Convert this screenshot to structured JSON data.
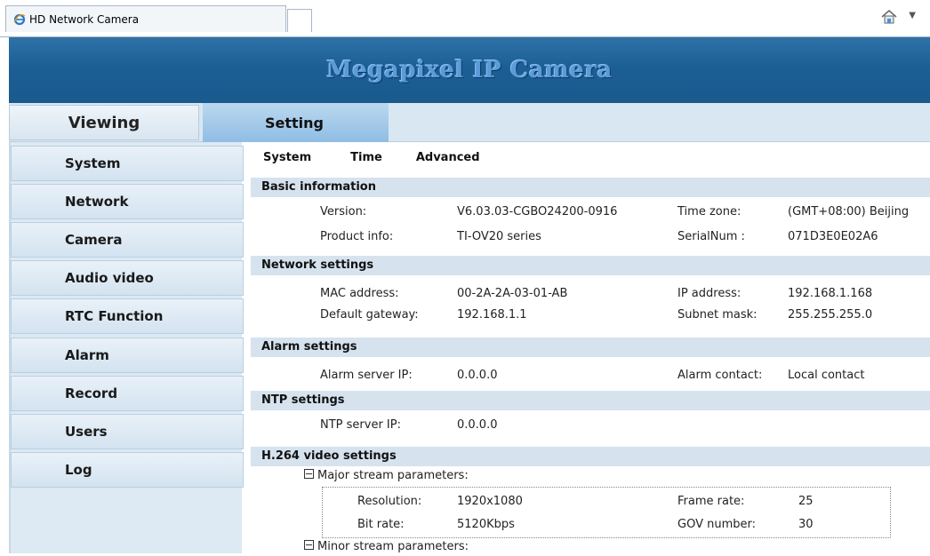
{
  "browser": {
    "tab_title": "HD Network Camera"
  },
  "banner": {
    "title": "Megapixel IP Camera"
  },
  "nav": {
    "viewing": "Viewing",
    "setting": "Setting"
  },
  "sidebar": {
    "items": [
      {
        "label": "System"
      },
      {
        "label": "Network"
      },
      {
        "label": "Camera"
      },
      {
        "label": "Audio video"
      },
      {
        "label": "RTC Function"
      },
      {
        "label": "Alarm"
      },
      {
        "label": "Record"
      },
      {
        "label": "Users"
      },
      {
        "label": "Log"
      }
    ]
  },
  "subtabs": [
    "System",
    "Time",
    "Advanced"
  ],
  "basic": {
    "heading": "Basic information",
    "version_label": "Version:",
    "version": "V6.03.03-CGBO24200-0916",
    "timezone_label": "Time zone:",
    "timezone": "(GMT+08:00) Beijing",
    "product_label": "Product info:",
    "product": "TI-OV20 series",
    "serial_label": "SerialNum :",
    "serial": "071D3E0E02A6"
  },
  "network": {
    "heading": "Network settings",
    "mac_label": "MAC address:",
    "mac": "00-2A-2A-03-01-AB",
    "ip_label": "IP address:",
    "ip": "192.168.1.168",
    "gw_label": "Default gateway:",
    "gw": "192.168.1.1",
    "mask_label": "Subnet mask:",
    "mask": "255.255.255.0"
  },
  "alarm": {
    "heading": "Alarm settings",
    "server_label": "Alarm server IP:",
    "server": "0.0.0.0",
    "contact_label": "Alarm contact:",
    "contact": "Local contact"
  },
  "ntp": {
    "heading": "NTP settings",
    "server_label": "NTP server IP:",
    "server": "0.0.0.0"
  },
  "h264": {
    "heading": "H.264 video settings",
    "major_label": "Major stream parameters:",
    "res_label": "Resolution:",
    "res": "1920x1080",
    "fps_label": "Frame rate:",
    "fps": "25",
    "bitrate_label": "Bit rate:",
    "bitrate": "5120Kbps",
    "gov_label": "GOV number:",
    "gov": "30",
    "minor_label": "Minor stream parameters:"
  }
}
